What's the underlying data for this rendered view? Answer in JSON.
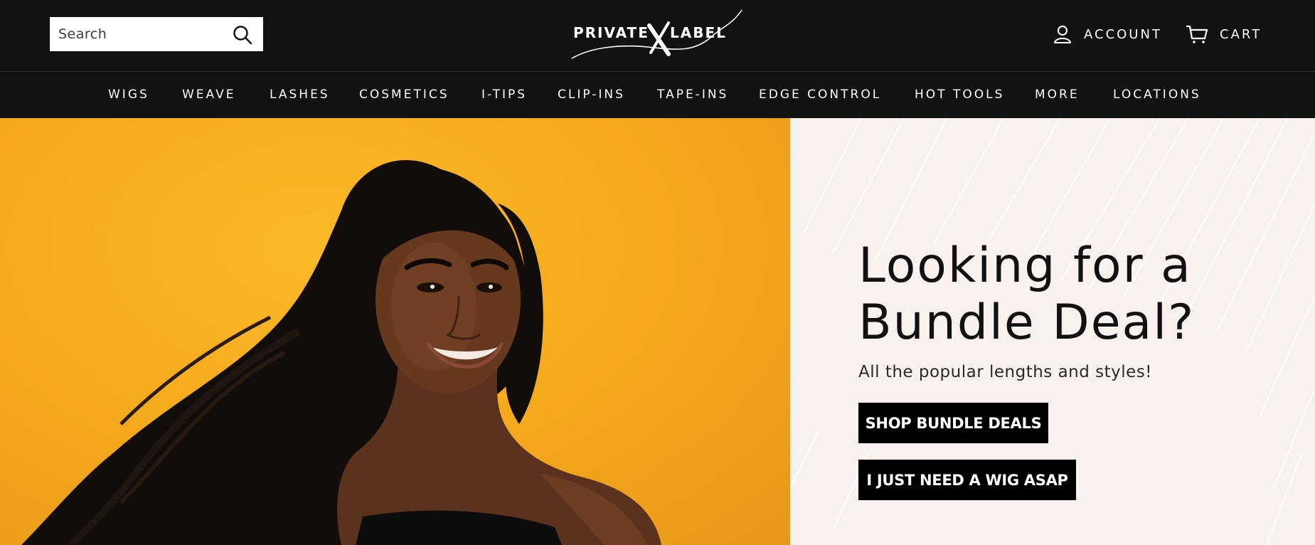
{
  "header": {
    "search": {
      "placeholder": "Search",
      "value": ""
    },
    "logo": {
      "left_word": "PRIVATE",
      "right_word": "LABEL",
      "mark": "X"
    },
    "account_label": "ACCOUNT",
    "cart_label": "CART"
  },
  "nav": {
    "items": [
      {
        "label": "WIGS"
      },
      {
        "label": "WEAVE"
      },
      {
        "label": "LASHES"
      },
      {
        "label": "COSMETICS"
      },
      {
        "label": "I-TIPS"
      },
      {
        "label": "CLIP-INS"
      },
      {
        "label": "TAPE-INS"
      },
      {
        "label": "EDGE CONTROL"
      },
      {
        "label": "HOT TOOLS"
      },
      {
        "label": "MORE"
      },
      {
        "label": "LOCATIONS"
      }
    ]
  },
  "hero": {
    "title_line1": "Looking for a",
    "title_line2": "Bundle Deal?",
    "subtitle": "All the popular lengths and styles!",
    "primary_cta": "SHOP BUNDLE DEALS",
    "secondary_cta": "I JUST NEED A WIG ASAP"
  },
  "colors": {
    "header_bg": "#111313",
    "hero_image_bg": "#f5ab1e",
    "panel_bg": "#f8f1ee",
    "button_bg": "#000000"
  },
  "icons": [
    "search-icon",
    "account-icon",
    "cart-icon"
  ]
}
